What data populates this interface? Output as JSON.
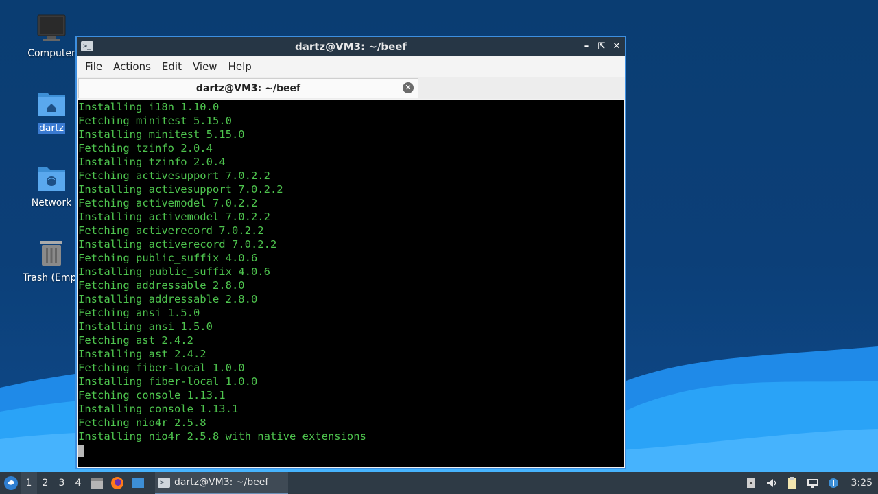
{
  "desktop": {
    "icons": [
      {
        "label": "Computer"
      },
      {
        "label": "dartz"
      },
      {
        "label": "Network"
      },
      {
        "label": "Trash (Empt"
      }
    ]
  },
  "window": {
    "title": "dartz@VM3: ~/beef",
    "menu": [
      "File",
      "Actions",
      "Edit",
      "View",
      "Help"
    ],
    "tab_label": "dartz@VM3: ~/beef",
    "terminal_lines": [
      "Installing i18n 1.10.0",
      "Fetching minitest 5.15.0",
      "Installing minitest 5.15.0",
      "Fetching tzinfo 2.0.4",
      "Installing tzinfo 2.0.4",
      "Fetching activesupport 7.0.2.2",
      "Installing activesupport 7.0.2.2",
      "Fetching activemodel 7.0.2.2",
      "Installing activemodel 7.0.2.2",
      "Fetching activerecord 7.0.2.2",
      "Installing activerecord 7.0.2.2",
      "Fetching public_suffix 4.0.6",
      "Installing public_suffix 4.0.6",
      "Fetching addressable 2.8.0",
      "Installing addressable 2.8.0",
      "Fetching ansi 1.5.0",
      "Installing ansi 1.5.0",
      "Fetching ast 2.4.2",
      "Installing ast 2.4.2",
      "Fetching fiber-local 1.0.0",
      "Installing fiber-local 1.0.0",
      "Fetching console 1.13.1",
      "Installing console 1.13.1",
      "Fetching nio4r 2.5.8",
      "Installing nio4r 2.5.8 with native extensions"
    ],
    "terminal_color": "#4ec44e"
  },
  "taskbar": {
    "workspaces": [
      "1",
      "2",
      "3",
      "4"
    ],
    "active_workspace": "1",
    "task_label": "dartz@VM3: ~/beef",
    "clock": "3:25"
  },
  "colors": {
    "window_border": "#3d8fe0",
    "titlebar": "#263645",
    "taskbar": "#2e3a45"
  }
}
